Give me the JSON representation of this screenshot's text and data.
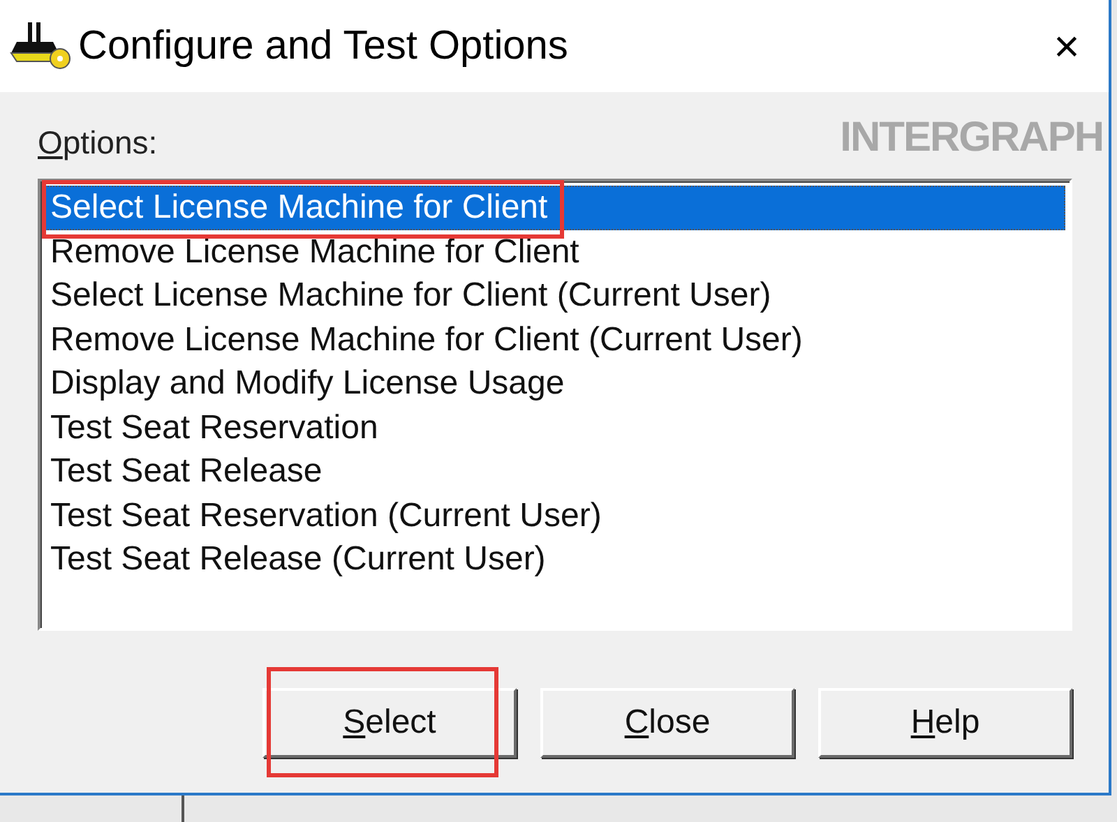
{
  "window": {
    "title": "Configure and Test Options",
    "close_glyph": "×"
  },
  "options_label": {
    "mnemonic": "O",
    "rest": "ptions:"
  },
  "logo": {
    "text": "INTERGRAPH"
  },
  "options": [
    {
      "label": "Select License Machine for Client",
      "selected": true,
      "annotated": true
    },
    {
      "label": "Remove License Machine for Client",
      "selected": false,
      "annotated": false
    },
    {
      "label": "Select License Machine for Client (Current User)",
      "selected": false,
      "annotated": false
    },
    {
      "label": "Remove License Machine for Client (Current User)",
      "selected": false,
      "annotated": false
    },
    {
      "label": "Display and Modify License Usage",
      "selected": false,
      "annotated": false
    },
    {
      "label": "Test Seat Reservation",
      "selected": false,
      "annotated": false
    },
    {
      "label": "Test Seat Release",
      "selected": false,
      "annotated": false
    },
    {
      "label": "Test Seat Reservation (Current User)",
      "selected": false,
      "annotated": false
    },
    {
      "label": "Test Seat Release (Current User)",
      "selected": false,
      "annotated": false
    }
  ],
  "buttons": [
    {
      "mnemonic": "S",
      "rest": "elect",
      "annotated": true
    },
    {
      "mnemonic": "C",
      "rest": "lose",
      "annotated": false
    },
    {
      "mnemonic": "H",
      "rest": "elp",
      "annotated": false
    }
  ]
}
